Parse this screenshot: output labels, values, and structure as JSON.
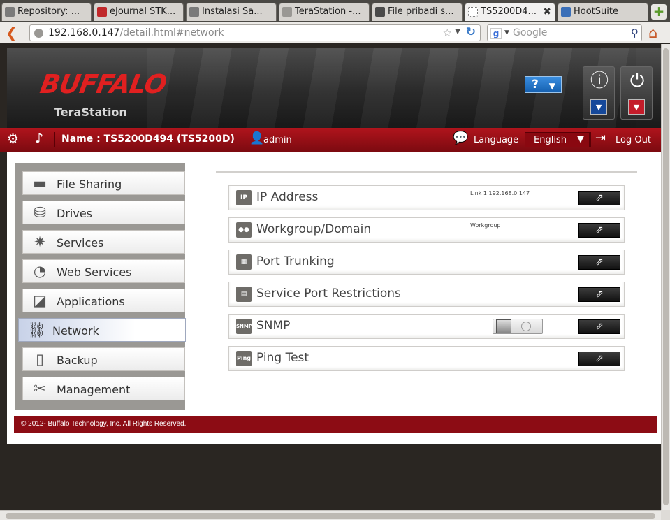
{
  "browser": {
    "tabs": [
      {
        "label": "Repository: ...",
        "fav_color": "#7a7a7a"
      },
      {
        "label": "eJournal STK...",
        "fav_color": "#c0282a"
      },
      {
        "label": "Instalasi Sa...",
        "fav_color": "#7a7a7a"
      },
      {
        "label": "TeraStation -...",
        "fav_color": "#9a9894"
      },
      {
        "label": "File pribadi s...",
        "fav_color": "#4a4a4a"
      },
      {
        "label": "TS5200D4...",
        "fav_color": "#ffffff",
        "active": true
      },
      {
        "label": "HootSuite",
        "fav_color": "#3a6fb8"
      }
    ],
    "new_tab": "+",
    "url_host": "192.168.0.147",
    "url_path": "/detail.html#network",
    "search_placeholder": "Google"
  },
  "header": {
    "logo": "BUFFALO",
    "product": "TeraStation",
    "help_label": "?",
    "help_arrow": "▼",
    "info_arrow": "▼",
    "power_arrow": "▼"
  },
  "toolbar": {
    "device_name": "Name : TS5200D494 (TS5200D)",
    "user": "admin",
    "language_label": "Language",
    "language_value": "English",
    "language_arrow": "▼",
    "logout_label": "Log Out"
  },
  "sidebar": {
    "items": [
      {
        "label": "File Sharing",
        "icon": "folder-icon",
        "glyph": "▬"
      },
      {
        "label": "Drives",
        "icon": "drive-icon",
        "glyph": "⛁"
      },
      {
        "label": "Services",
        "icon": "services-icon",
        "glyph": "✷"
      },
      {
        "label": "Web Services",
        "icon": "web-services-icon",
        "glyph": "◔"
      },
      {
        "label": "Applications",
        "icon": "applications-icon",
        "glyph": "◪"
      },
      {
        "label": "Network",
        "icon": "network-icon",
        "glyph": "⛓",
        "active": true
      },
      {
        "label": "Backup",
        "icon": "backup-icon",
        "glyph": "▯"
      },
      {
        "label": "Management",
        "icon": "management-icon",
        "glyph": "✂"
      }
    ]
  },
  "network": {
    "rows": [
      {
        "label": "IP Address",
        "icon": "ip-icon",
        "icon_text": "IP",
        "info": "Link 1 192.168.0.147"
      },
      {
        "label": "Workgroup/Domain",
        "icon": "workgroup-icon",
        "icon_text": "●●",
        "info": "Workgroup"
      },
      {
        "label": "Port Trunking",
        "icon": "port-trunking-icon",
        "icon_text": "▦",
        "info": ""
      },
      {
        "label": "Service Port Restrictions",
        "icon": "service-port-icon",
        "icon_text": "▤",
        "info": ""
      },
      {
        "label": "SNMP",
        "icon": "snmp-icon",
        "icon_text": "SNMP",
        "info": "",
        "toggle": "off"
      },
      {
        "label": "Ping Test",
        "icon": "ping-icon",
        "icon_text": "Ping",
        "info": ""
      }
    ],
    "open_glyph": "⇗"
  },
  "footer": {
    "copyright": "© 2012- Buffalo Technology, Inc. All Rights Reserved."
  },
  "colors": {
    "brand_red": "#e02020",
    "bar_red": "#9c1018",
    "help_blue": "#1f74c8"
  }
}
